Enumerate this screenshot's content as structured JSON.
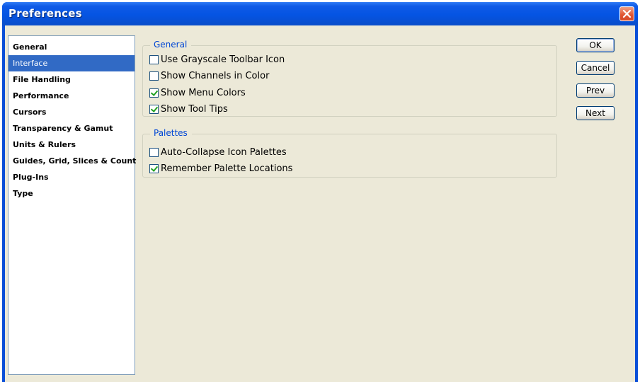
{
  "window": {
    "title": "Preferences"
  },
  "nav": {
    "items": [
      {
        "label": "General",
        "selected": false
      },
      {
        "label": "Interface",
        "selected": true
      },
      {
        "label": "File Handling",
        "selected": false
      },
      {
        "label": "Performance",
        "selected": false
      },
      {
        "label": "Cursors",
        "selected": false
      },
      {
        "label": "Transparency & Gamut",
        "selected": false
      },
      {
        "label": "Units & Rulers",
        "selected": false
      },
      {
        "label": "Guides, Grid, Slices & Count",
        "selected": false
      },
      {
        "label": "Plug-Ins",
        "selected": false
      },
      {
        "label": "Type",
        "selected": false
      }
    ]
  },
  "general_group": {
    "legend": "General",
    "options": [
      {
        "label": "Use Grayscale Toolbar Icon",
        "checked": false
      },
      {
        "label": "Show Channels in Color",
        "checked": false
      },
      {
        "label": "Show Menu Colors",
        "checked": true
      },
      {
        "label": "Show Tool Tips",
        "checked": true
      }
    ]
  },
  "palettes_group": {
    "legend": "Palettes",
    "options": [
      {
        "label": "Auto-Collapse Icon Palettes",
        "checked": false
      },
      {
        "label": "Remember Palette Locations",
        "checked": true
      }
    ]
  },
  "buttons": {
    "ok": "OK",
    "cancel": "Cancel",
    "prev": "Prev",
    "next": "Next"
  },
  "colors": {
    "titlebar": "#0554e3",
    "selection": "#316ac5",
    "legend_text": "#0046d5",
    "dialog_bg": "#ece9d8"
  }
}
